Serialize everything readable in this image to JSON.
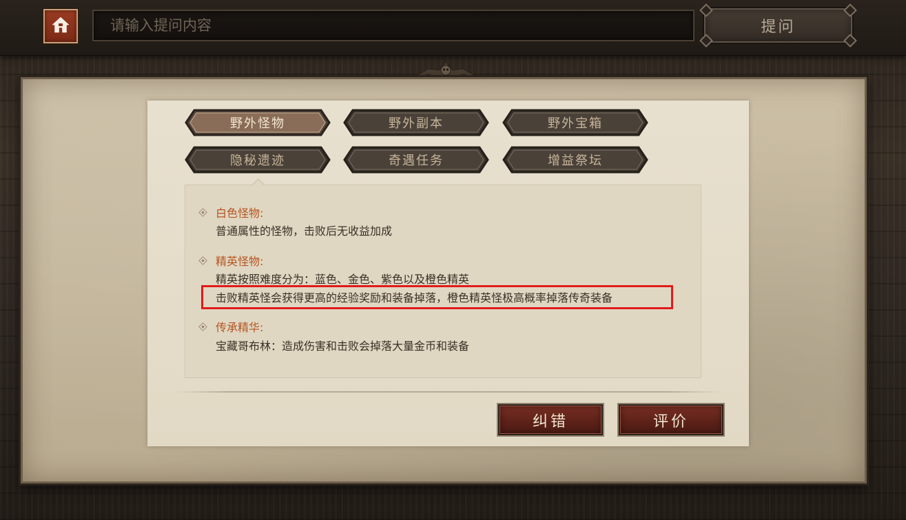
{
  "header": {
    "home_icon": "home-icon",
    "search_placeholder": "请输入提问内容",
    "ask_label": "提问"
  },
  "tabs": [
    {
      "label": "野外怪物",
      "active": true
    },
    {
      "label": "野外副本",
      "active": false
    },
    {
      "label": "野外宝箱",
      "active": false
    },
    {
      "label": "隐秘遗迹",
      "active": false
    },
    {
      "label": "奇遇任务",
      "active": false
    },
    {
      "label": "增益祭坛",
      "active": false
    }
  ],
  "content": {
    "sections": [
      {
        "title": "白色怪物:",
        "lines": [
          "普通属性的怪物，击败后无收益加成"
        ]
      },
      {
        "title": "精英怪物:",
        "lines": [
          "精英按照难度分为：蓝色、金色、紫色以及橙色精英",
          "击败精英怪会获得更高的经验奖励和装备掉落，橙色精英怪极高概率掉落传奇装备"
        ]
      },
      {
        "title": "传承精华:",
        "lines": [
          "宝藏哥布林：造成伤害和击败会掉落大量金币和装备"
        ]
      }
    ]
  },
  "actions": {
    "correct_label": "纠错",
    "rate_label": "评价"
  },
  "colors": {
    "accent_red": "#e11a1a",
    "section_title": "#b4541f",
    "button_red": "#6a261c"
  }
}
